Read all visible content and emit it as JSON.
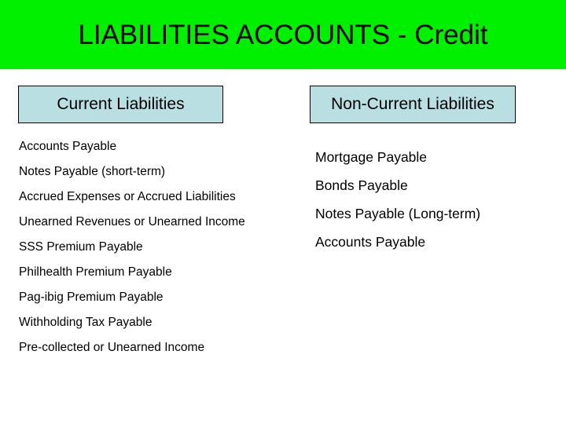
{
  "slide": {
    "title": "LIABILITIES ACCOUNTS - Credit",
    "title_band_color": "#00f000",
    "header_box_color": "#b9dfe3",
    "background_color": "#ffffff",
    "text_color": "#000000"
  },
  "columns": {
    "left": {
      "heading": "Current Liabilities",
      "items": [
        "Accounts Payable",
        "Notes Payable (short-term)",
        "Accrued Expenses or Accrued Liabilities",
        "Unearned Revenues or Unearned Income",
        "SSS Premium Payable",
        "Philhealth Premium Payable",
        "Pag-ibig Premium Payable",
        "Withholding Tax Payable",
        "Pre-collected or Unearned Income"
      ]
    },
    "right": {
      "heading": "Non-Current Liabilities",
      "items": [
        "Mortgage Payable",
        "Bonds Payable",
        "Notes Payable (Long-term)",
        "Accounts Payable"
      ]
    }
  }
}
